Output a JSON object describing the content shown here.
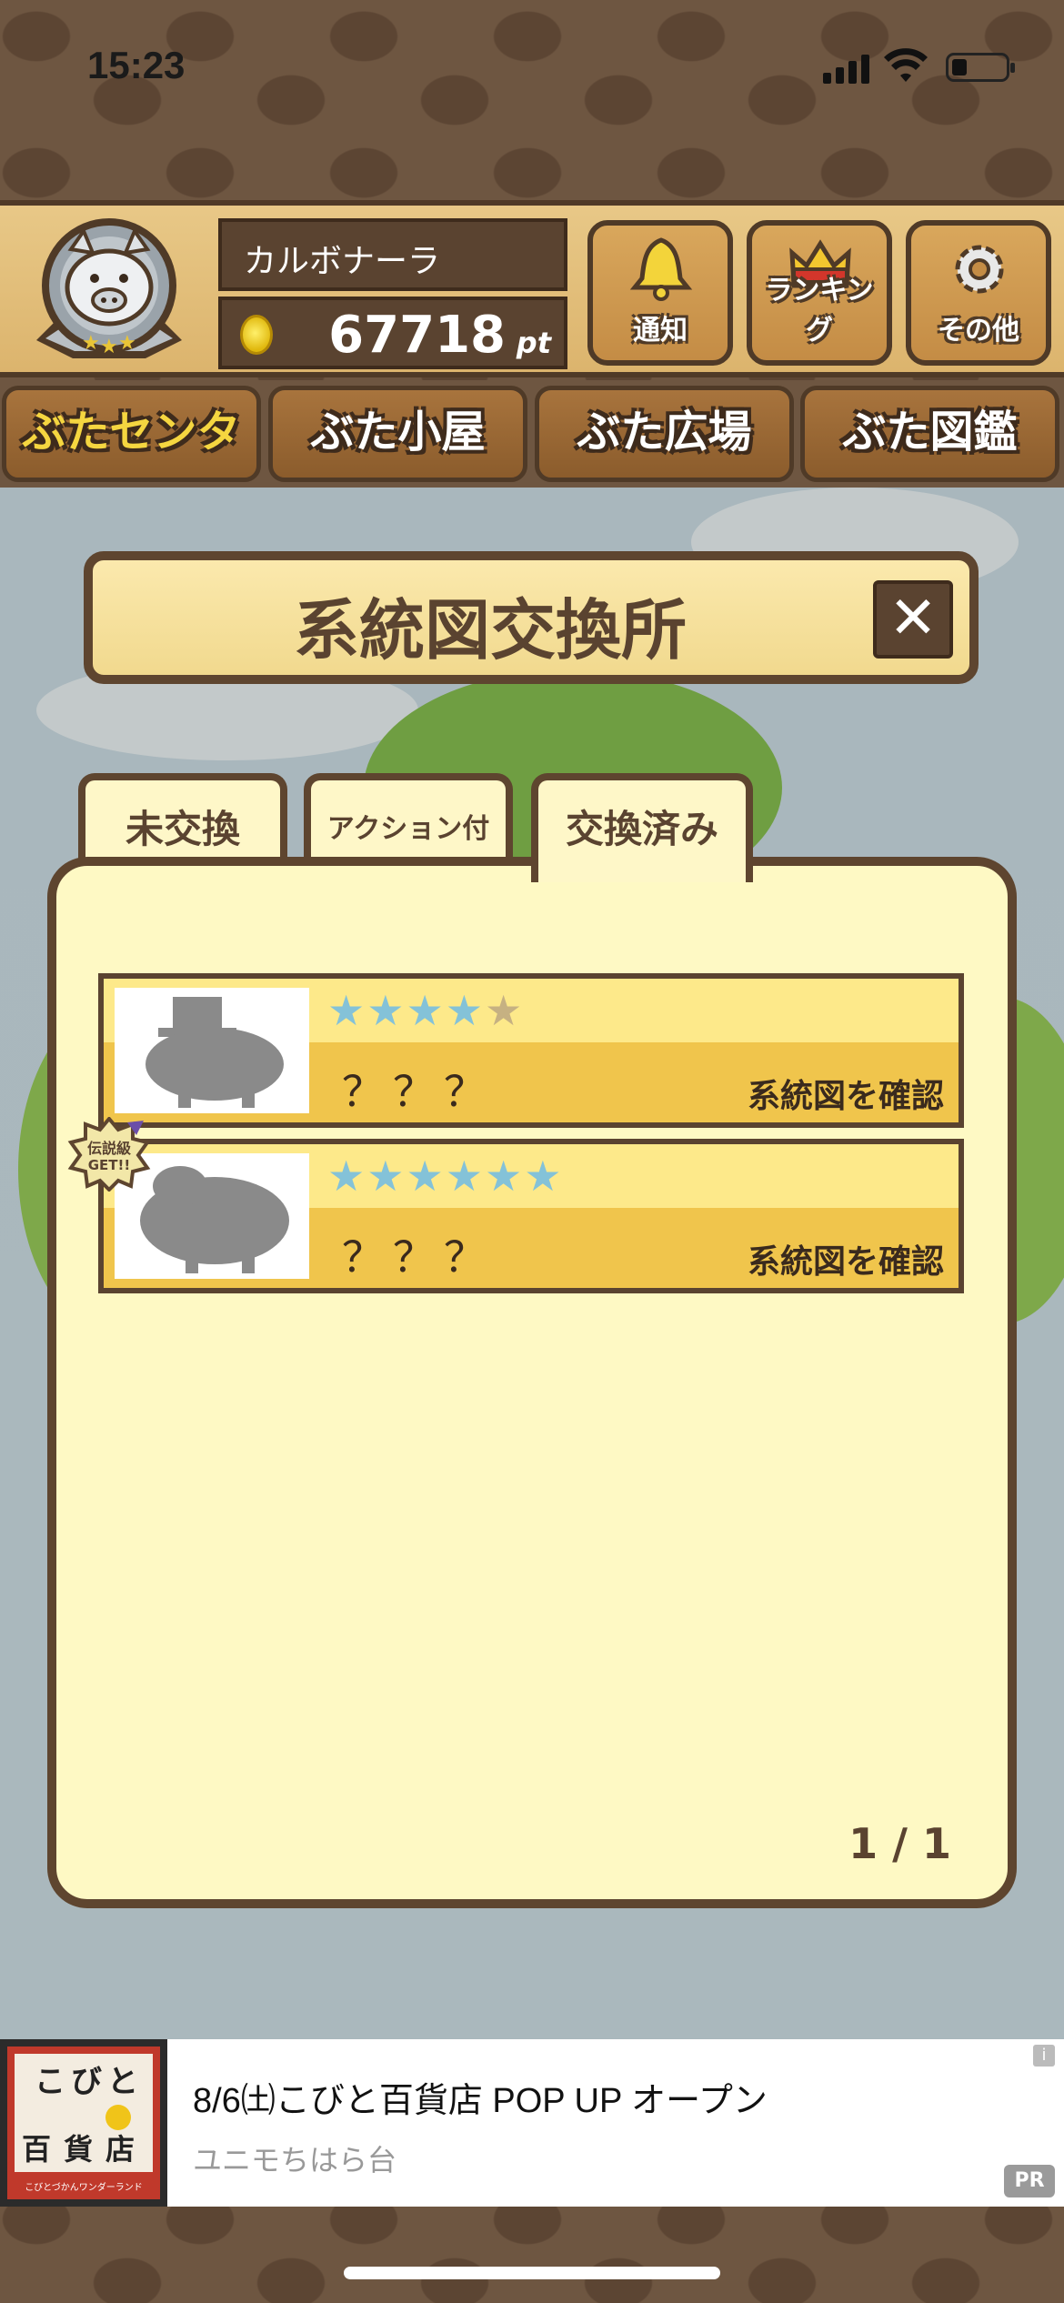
{
  "status_bar": {
    "time": "15:23"
  },
  "header": {
    "player_name": "カルボナーラ",
    "points": "67718",
    "points_unit": "pt",
    "buttons": [
      {
        "label": "通知",
        "icon": "bell-icon"
      },
      {
        "label": "ランキング",
        "icon": "crown-icon"
      },
      {
        "label": "その他",
        "icon": "gear-icon"
      }
    ]
  },
  "nav": {
    "items": [
      {
        "label": "ぶたセンター",
        "active": true
      },
      {
        "label": "ぶた小屋",
        "active": false
      },
      {
        "label": "ぶた広場",
        "active": false
      },
      {
        "label": "ぶた図鑑",
        "active": false
      }
    ]
  },
  "dialog": {
    "title": "系統図交換所",
    "close_label": "✕",
    "tabs": [
      {
        "label": "未交換",
        "active": false
      },
      {
        "label": "アクション付",
        "active": false
      },
      {
        "label": "交換済み",
        "active": true
      }
    ],
    "rows": [
      {
        "stars_on": 4,
        "stars_total": 5,
        "name": "？？？",
        "action": "系統図を確認"
      },
      {
        "stars_on": 6,
        "stars_total": 6,
        "name": "？？？",
        "action": "系統図を確認",
        "badge": "伝説級 GET!!"
      }
    ],
    "page": "1 / 1"
  },
  "ad": {
    "title": "8/6㈯こびと百貨店 POP UP オープン",
    "subtitle": "ユニモちはら台",
    "pr": "PR",
    "info": "i",
    "image_text": "こびと百貨店",
    "image_caption": "こびとづかんワンダーランド"
  }
}
